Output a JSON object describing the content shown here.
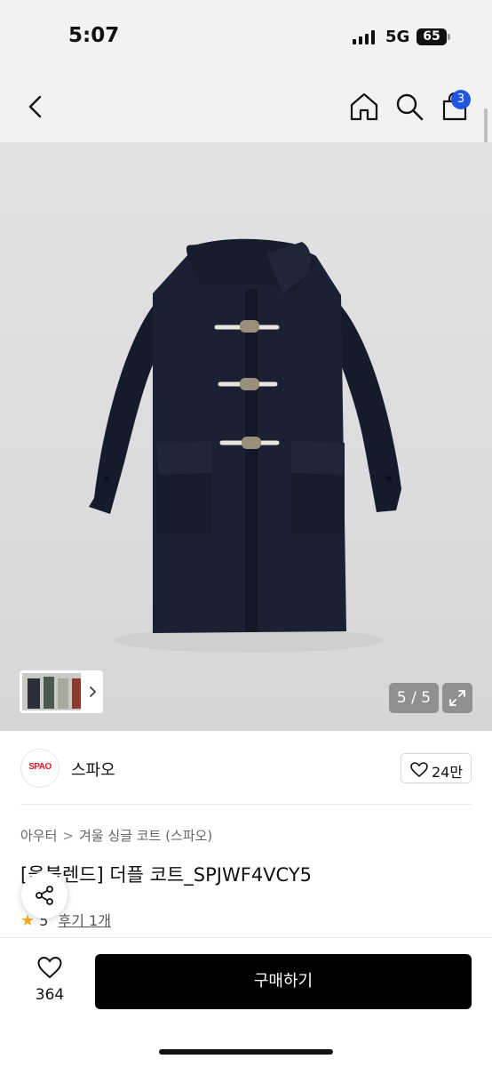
{
  "status": {
    "time": "5:07",
    "network": "5G",
    "battery": "65"
  },
  "nav": {
    "cart_count": "3"
  },
  "gallery": {
    "counter": "5 / 5"
  },
  "brand": {
    "name": "스파오",
    "logo_text": "SPAO",
    "likes": "24만"
  },
  "breadcrumb": {
    "level1": "아우터",
    "separator": ">",
    "level2": "겨울 싱글 코트 (스파오)"
  },
  "product": {
    "title": "[울블렌드] 더플 코트_SPJWF4VCY5",
    "rating": "5",
    "reviews": "후기 1개"
  },
  "bottom": {
    "wish_count": "364",
    "buy_label": "구매하기"
  },
  "colors": {
    "accent_badge": "#2356e0",
    "star": "#f5a623",
    "brand_red": "#e01e24",
    "coat": "#1a2133"
  },
  "icons": [
    "back-icon",
    "home-icon",
    "search-icon",
    "cart-icon",
    "chevron-right-icon",
    "expand-icon",
    "heart-icon",
    "share-icon",
    "star-icon"
  ]
}
